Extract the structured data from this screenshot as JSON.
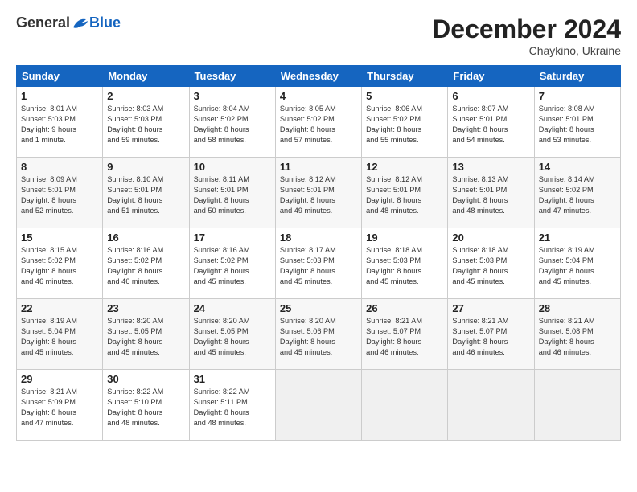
{
  "header": {
    "logo_general": "General",
    "logo_blue": "Blue",
    "month_title": "December 2024",
    "subtitle": "Chaykino, Ukraine"
  },
  "weekdays": [
    "Sunday",
    "Monday",
    "Tuesday",
    "Wednesday",
    "Thursday",
    "Friday",
    "Saturday"
  ],
  "weeks": [
    [
      {
        "day": "1",
        "info": "Sunrise: 8:01 AM\nSunset: 5:03 PM\nDaylight: 9 hours\nand 1 minute."
      },
      {
        "day": "2",
        "info": "Sunrise: 8:03 AM\nSunset: 5:03 PM\nDaylight: 8 hours\nand 59 minutes."
      },
      {
        "day": "3",
        "info": "Sunrise: 8:04 AM\nSunset: 5:02 PM\nDaylight: 8 hours\nand 58 minutes."
      },
      {
        "day": "4",
        "info": "Sunrise: 8:05 AM\nSunset: 5:02 PM\nDaylight: 8 hours\nand 57 minutes."
      },
      {
        "day": "5",
        "info": "Sunrise: 8:06 AM\nSunset: 5:02 PM\nDaylight: 8 hours\nand 55 minutes."
      },
      {
        "day": "6",
        "info": "Sunrise: 8:07 AM\nSunset: 5:01 PM\nDaylight: 8 hours\nand 54 minutes."
      },
      {
        "day": "7",
        "info": "Sunrise: 8:08 AM\nSunset: 5:01 PM\nDaylight: 8 hours\nand 53 minutes."
      }
    ],
    [
      {
        "day": "8",
        "info": "Sunrise: 8:09 AM\nSunset: 5:01 PM\nDaylight: 8 hours\nand 52 minutes."
      },
      {
        "day": "9",
        "info": "Sunrise: 8:10 AM\nSunset: 5:01 PM\nDaylight: 8 hours\nand 51 minutes."
      },
      {
        "day": "10",
        "info": "Sunrise: 8:11 AM\nSunset: 5:01 PM\nDaylight: 8 hours\nand 50 minutes."
      },
      {
        "day": "11",
        "info": "Sunrise: 8:12 AM\nSunset: 5:01 PM\nDaylight: 8 hours\nand 49 minutes."
      },
      {
        "day": "12",
        "info": "Sunrise: 8:12 AM\nSunset: 5:01 PM\nDaylight: 8 hours\nand 48 minutes."
      },
      {
        "day": "13",
        "info": "Sunrise: 8:13 AM\nSunset: 5:01 PM\nDaylight: 8 hours\nand 48 minutes."
      },
      {
        "day": "14",
        "info": "Sunrise: 8:14 AM\nSunset: 5:02 PM\nDaylight: 8 hours\nand 47 minutes."
      }
    ],
    [
      {
        "day": "15",
        "info": "Sunrise: 8:15 AM\nSunset: 5:02 PM\nDaylight: 8 hours\nand 46 minutes."
      },
      {
        "day": "16",
        "info": "Sunrise: 8:16 AM\nSunset: 5:02 PM\nDaylight: 8 hours\nand 46 minutes."
      },
      {
        "day": "17",
        "info": "Sunrise: 8:16 AM\nSunset: 5:02 PM\nDaylight: 8 hours\nand 45 minutes."
      },
      {
        "day": "18",
        "info": "Sunrise: 8:17 AM\nSunset: 5:03 PM\nDaylight: 8 hours\nand 45 minutes."
      },
      {
        "day": "19",
        "info": "Sunrise: 8:18 AM\nSunset: 5:03 PM\nDaylight: 8 hours\nand 45 minutes."
      },
      {
        "day": "20",
        "info": "Sunrise: 8:18 AM\nSunset: 5:03 PM\nDaylight: 8 hours\nand 45 minutes."
      },
      {
        "day": "21",
        "info": "Sunrise: 8:19 AM\nSunset: 5:04 PM\nDaylight: 8 hours\nand 45 minutes."
      }
    ],
    [
      {
        "day": "22",
        "info": "Sunrise: 8:19 AM\nSunset: 5:04 PM\nDaylight: 8 hours\nand 45 minutes."
      },
      {
        "day": "23",
        "info": "Sunrise: 8:20 AM\nSunset: 5:05 PM\nDaylight: 8 hours\nand 45 minutes."
      },
      {
        "day": "24",
        "info": "Sunrise: 8:20 AM\nSunset: 5:05 PM\nDaylight: 8 hours\nand 45 minutes."
      },
      {
        "day": "25",
        "info": "Sunrise: 8:20 AM\nSunset: 5:06 PM\nDaylight: 8 hours\nand 45 minutes."
      },
      {
        "day": "26",
        "info": "Sunrise: 8:21 AM\nSunset: 5:07 PM\nDaylight: 8 hours\nand 46 minutes."
      },
      {
        "day": "27",
        "info": "Sunrise: 8:21 AM\nSunset: 5:07 PM\nDaylight: 8 hours\nand 46 minutes."
      },
      {
        "day": "28",
        "info": "Sunrise: 8:21 AM\nSunset: 5:08 PM\nDaylight: 8 hours\nand 46 minutes."
      }
    ],
    [
      {
        "day": "29",
        "info": "Sunrise: 8:21 AM\nSunset: 5:09 PM\nDaylight: 8 hours\nand 47 minutes."
      },
      {
        "day": "30",
        "info": "Sunrise: 8:22 AM\nSunset: 5:10 PM\nDaylight: 8 hours\nand 48 minutes."
      },
      {
        "day": "31",
        "info": "Sunrise: 8:22 AM\nSunset: 5:11 PM\nDaylight: 8 hours\nand 48 minutes."
      },
      {
        "day": "",
        "info": ""
      },
      {
        "day": "",
        "info": ""
      },
      {
        "day": "",
        "info": ""
      },
      {
        "day": "",
        "info": ""
      }
    ]
  ]
}
